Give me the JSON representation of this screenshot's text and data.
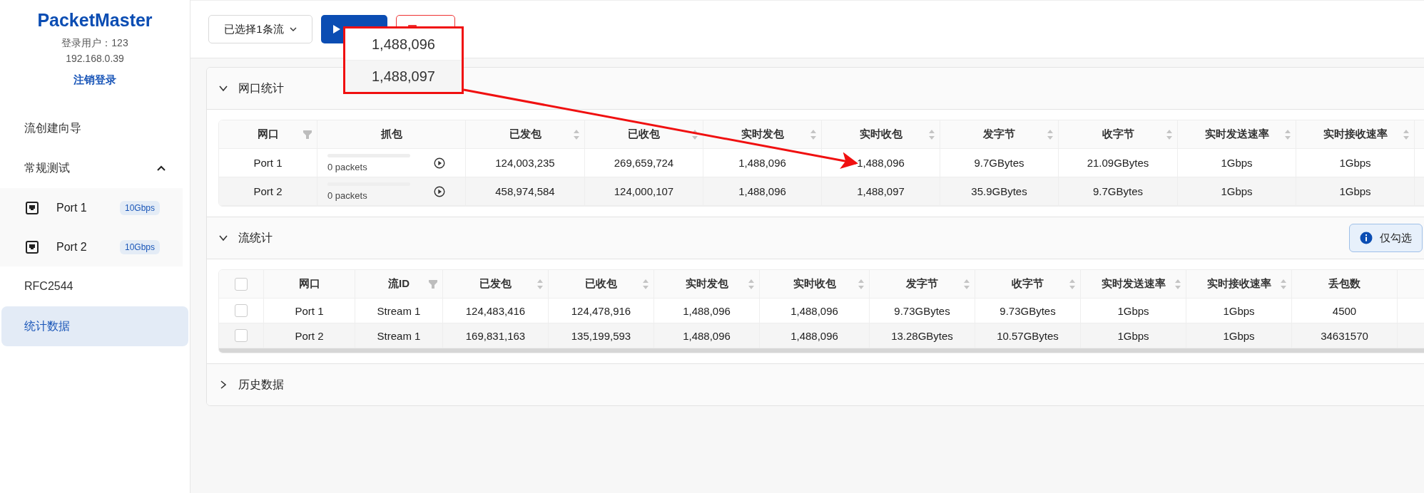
{
  "sidebar": {
    "brand": "PacketMaster",
    "user": "登录用户：123",
    "ip": "192.168.0.39",
    "logout": "注销登录",
    "items": [
      {
        "kind": "item",
        "label": "流创建向导",
        "selected": false
      },
      {
        "kind": "group",
        "label": "常规测试",
        "selected": false,
        "expanded": true,
        "children": [
          {
            "kind": "port",
            "label": "Port 1",
            "badge": "10Gbps",
            "selected": false
          },
          {
            "kind": "port",
            "label": "Port 2",
            "badge": "10Gbps",
            "selected": false
          }
        ]
      },
      {
        "kind": "item",
        "label": "RFC2544",
        "selected": false
      },
      {
        "kind": "item",
        "label": "统计数据",
        "selected": true
      }
    ]
  },
  "toolbar": {
    "stream_select": "已选择1条流"
  },
  "sections": [
    {
      "title": "网口统计",
      "expanded": true,
      "table": {
        "kind": "port",
        "columns": [
          {
            "label": "网口",
            "filter": true,
            "sort": false
          },
          {
            "label": "抓包",
            "filter": false,
            "sort": false
          },
          {
            "label": "已发包",
            "filter": false,
            "sort": true
          },
          {
            "label": "已收包",
            "filter": false,
            "sort": true
          },
          {
            "label": "实时发包",
            "filter": false,
            "sort": true
          },
          {
            "label": "实时收包",
            "filter": false,
            "sort": true
          },
          {
            "label": "发字节",
            "filter": false,
            "sort": true
          },
          {
            "label": "收字节",
            "filter": false,
            "sort": true
          },
          {
            "label": "实时发送速率",
            "filter": false,
            "sort": true
          },
          {
            "label": "实时接收速率",
            "filter": false,
            "sort": true
          }
        ],
        "rows": [
          {
            "cells": [
              "Port 1",
              {
                "level": 0,
                "text": "0 packets"
              },
              "124,003,235",
              "269,659,724",
              "1,488,096",
              "1,488,096",
              "9.7GBytes",
              "21.09GBytes",
              "1Gbps",
              "1Gbps"
            ]
          },
          {
            "cells": [
              "Port 2",
              {
                "level": 0,
                "text": "0 packets"
              },
              "458,974,584",
              "124,000,107",
              "1,488,096",
              "1,488,097",
              "35.9GBytes",
              "9.7GBytes",
              "1Gbps",
              "1Gbps"
            ]
          }
        ]
      }
    },
    {
      "title": "流统计",
      "expanded": true,
      "notice": "仅勾选",
      "table": {
        "kind": "stream",
        "select_all_checked": false,
        "columns": [
          {
            "label": "网口",
            "filter": false,
            "sort": false
          },
          {
            "label": "流ID",
            "filter": true,
            "sort": false
          },
          {
            "label": "已发包",
            "filter": false,
            "sort": true
          },
          {
            "label": "已收包",
            "filter": false,
            "sort": true
          },
          {
            "label": "实时发包",
            "filter": false,
            "sort": true
          },
          {
            "label": "实时收包",
            "filter": false,
            "sort": true
          },
          {
            "label": "发字节",
            "filter": false,
            "sort": true
          },
          {
            "label": "收字节",
            "filter": false,
            "sort": true
          },
          {
            "label": "实时发送速率",
            "filter": false,
            "sort": true
          },
          {
            "label": "实时接收速率",
            "filter": false,
            "sort": true
          },
          {
            "label": "丢包数",
            "filter": false,
            "sort": false
          }
        ],
        "rows": [
          {
            "checked": false,
            "cells": [
              "Port 1",
              "Stream 1",
              "124,483,416",
              "124,478,916",
              "1,488,096",
              "1,488,096",
              "9.73GBytes",
              "9.73GBytes",
              "1Gbps",
              "1Gbps",
              "4500"
            ]
          },
          {
            "checked": false,
            "cells": [
              "Port 2",
              "Stream 1",
              "169,831,163",
              "135,199,593",
              "1,488,096",
              "1,488,096",
              "13.28GBytes",
              "10.57GBytes",
              "1Gbps",
              "1Gbps",
              "34631570"
            ]
          }
        ]
      }
    },
    {
      "title": "历史数据",
      "expanded": false
    }
  ],
  "callout": {
    "values": [
      "1,488,096",
      "1,488,097"
    ]
  }
}
